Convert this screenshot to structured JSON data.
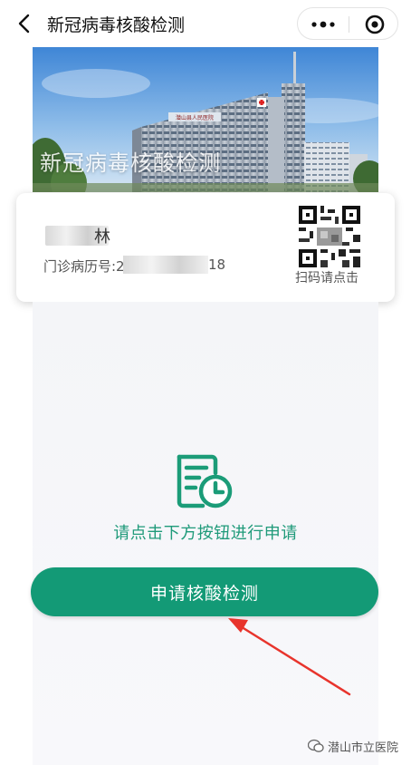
{
  "header": {
    "title": "新冠病毒核酸检测"
  },
  "banner": {
    "title": "新冠病毒核酸检测",
    "sign_text": "潜山县人民医院"
  },
  "patient": {
    "name_visible": "林",
    "record_label": "门诊病历号:2",
    "record_suffix": "18",
    "qr_label": "扫码请点击"
  },
  "main": {
    "hint": "请点击下方按钮进行申请",
    "apply_button": "申请核酸检测"
  },
  "watermark": {
    "text": "潜山市立医院"
  },
  "colors": {
    "accent": "#139a76",
    "hint": "#1f9a7a",
    "arrow": "#e8342c"
  }
}
